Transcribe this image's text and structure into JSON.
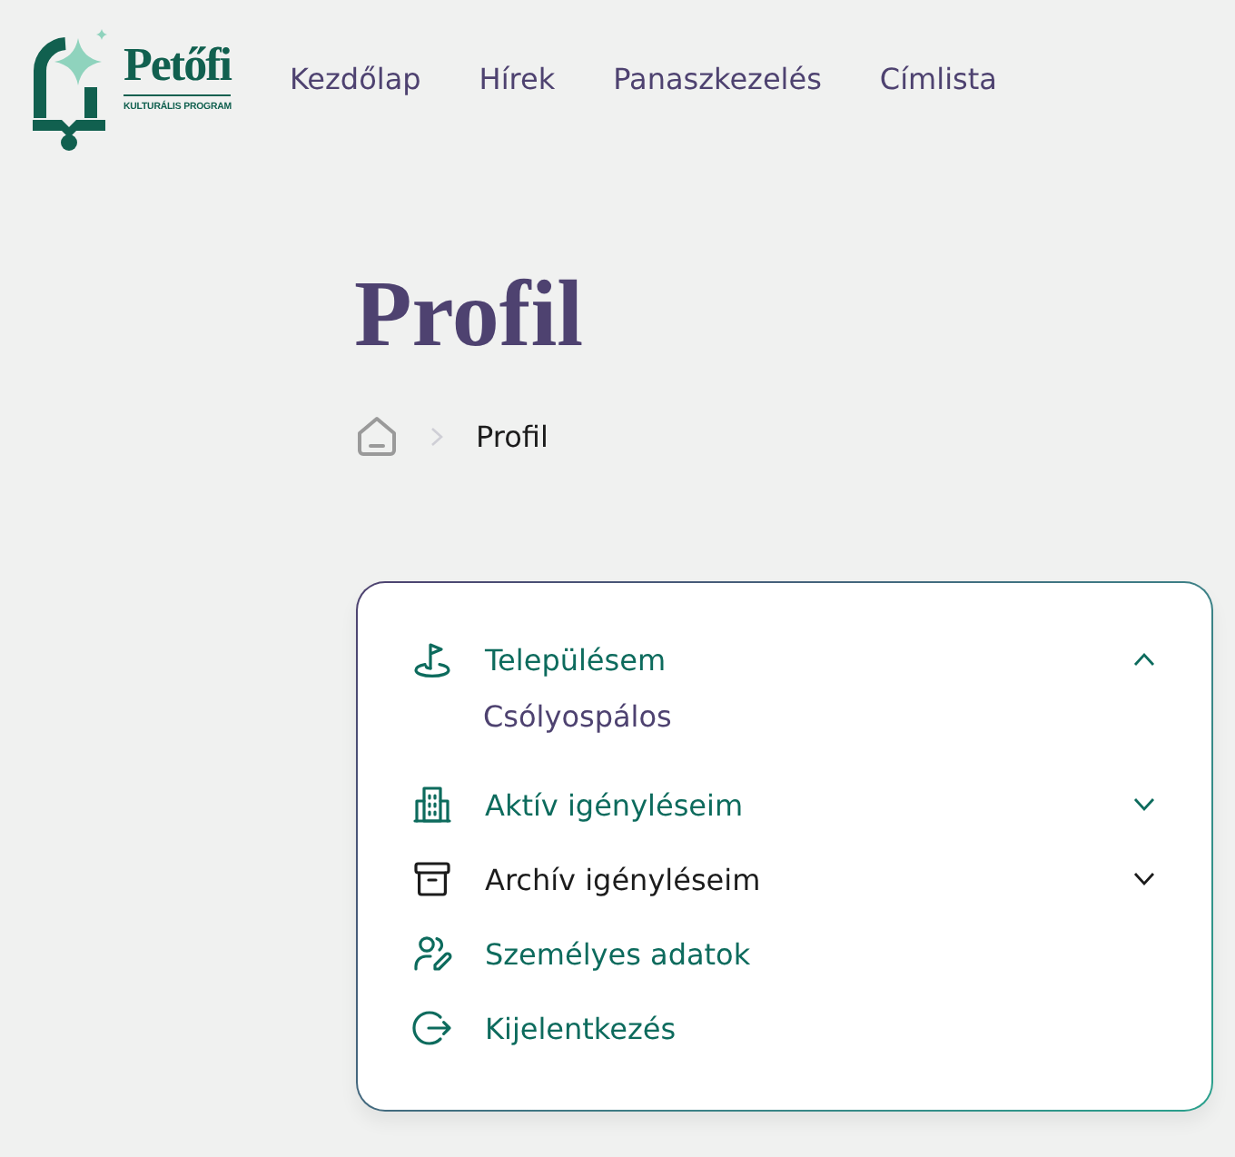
{
  "header": {
    "logo": {
      "title": "Petőfi",
      "subtitle": "KULTURÁLIS PROGRAM"
    },
    "nav": [
      {
        "label": "Kezdőlap"
      },
      {
        "label": "Hírek"
      },
      {
        "label": "Panaszkezelés"
      },
      {
        "label": "Címlista"
      }
    ]
  },
  "page": {
    "title": "Profil",
    "breadcrumb": [
      {
        "label": "Profil"
      }
    ]
  },
  "menu": [
    {
      "kind": "accordion",
      "label": "Településem",
      "expanded": true,
      "hovered": false,
      "value": "Csólyospálos"
    },
    {
      "kind": "accordion",
      "label": "Aktív igényléseim",
      "expanded": false,
      "hovered": false
    },
    {
      "kind": "accordion",
      "label": "Archív igényléseim",
      "expanded": false,
      "hovered": true
    },
    {
      "kind": "link",
      "label": "Személyes adatok",
      "hovered": false
    },
    {
      "kind": "link",
      "label": "Kijelentkezés",
      "hovered": false
    }
  ]
}
